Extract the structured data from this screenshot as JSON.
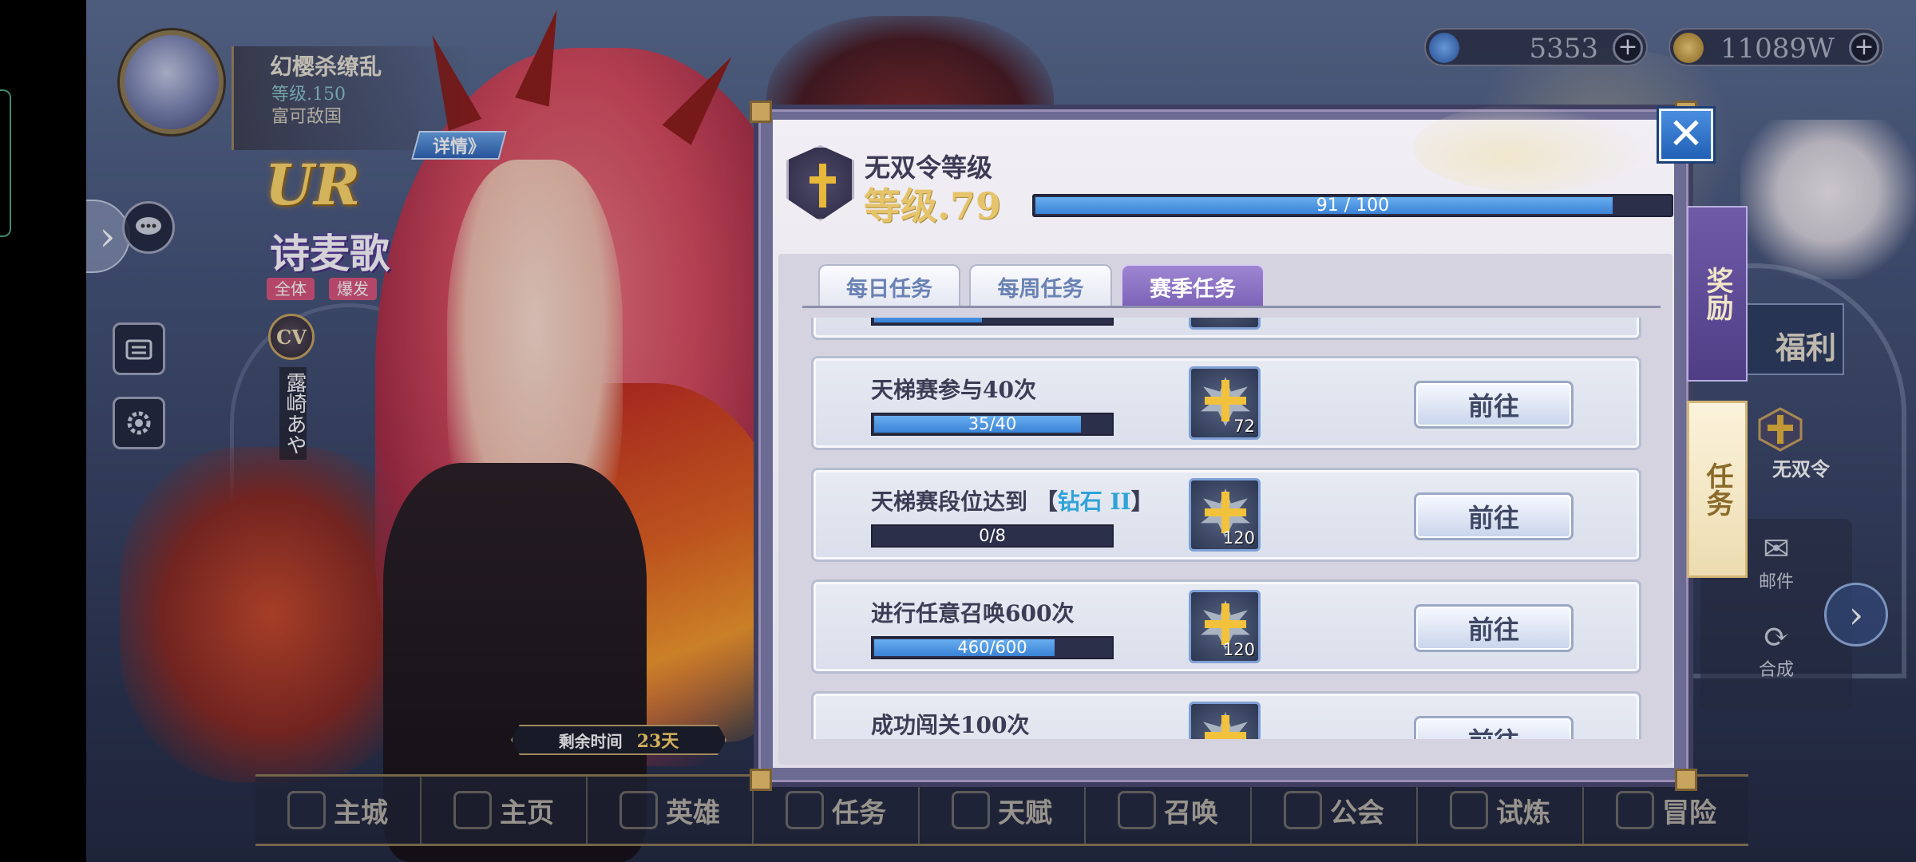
{
  "player": {
    "name": "幻樱杀缭乱",
    "level": "等级.150",
    "guild": "富可敌国"
  },
  "hero": {
    "rarity": "UR",
    "detail_label": "详情》",
    "name": "诗麦歌",
    "tags": [
      "全体",
      "爆发"
    ],
    "cv_label": "CV",
    "cv_name": "露崎あや"
  },
  "currencies": [
    {
      "icon": "diamond-icon",
      "value": "5353"
    },
    {
      "icon": "gold-coin-icon",
      "value": "11089W"
    }
  ],
  "remaining": {
    "label": "剩余时间",
    "value": "23天"
  },
  "right_menu": {
    "fuli": "福利",
    "wushuang": "无双令",
    "mail": "邮件",
    "compose": "合成"
  },
  "bottom_nav": [
    "主城",
    "主页",
    "英雄",
    "任务",
    "天赋",
    "召唤",
    "公会",
    "试炼",
    "冒险"
  ],
  "pass": {
    "title": "无双令等级",
    "level": "等级.79",
    "progress_text": "91 / 100",
    "progress": 0.91
  },
  "side_tabs": {
    "reward": "奖励",
    "task": "任务"
  },
  "tabs": [
    {
      "label": "每日任务",
      "active": false
    },
    {
      "label": "每周任务",
      "active": false
    },
    {
      "label": "赛季任务",
      "active": true
    }
  ],
  "tasks": [
    {
      "name": "天梯赛参与40次",
      "progress_text": "35/40",
      "progress": 0.875,
      "reward_qty": "72",
      "button": "前往"
    },
    {
      "name_prefix": "天梯赛段位达到 【",
      "name_highlight": "钻石 II",
      "name_suffix": "】",
      "progress_text": "0/8",
      "progress": 0,
      "reward_qty": "120",
      "button": "前往"
    },
    {
      "name": "进行任意召唤600次",
      "progress_text": "460/600",
      "progress": 0.767,
      "reward_qty": "120",
      "button": "前往"
    },
    {
      "name": "成功闯关100次",
      "button": "前往"
    }
  ],
  "colors": {
    "accent_blue": "#3a83d6",
    "tab_active": "#7b62b7",
    "highlight_cyan": "#2fa3d8",
    "level_gold": "#e6c46b"
  }
}
